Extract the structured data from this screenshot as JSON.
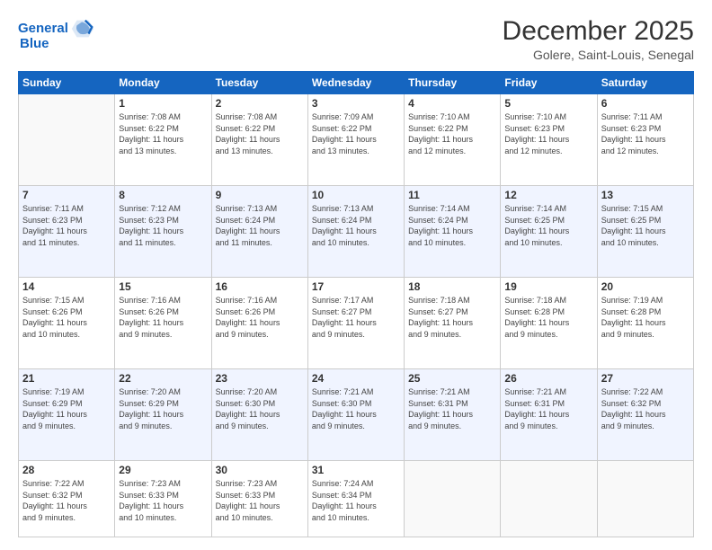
{
  "header": {
    "logo_line1": "General",
    "logo_line2": "Blue",
    "month_year": "December 2025",
    "location": "Golere, Saint-Louis, Senegal"
  },
  "days_of_week": [
    "Sunday",
    "Monday",
    "Tuesday",
    "Wednesday",
    "Thursday",
    "Friday",
    "Saturday"
  ],
  "weeks": [
    [
      {
        "day": "",
        "info": ""
      },
      {
        "day": "1",
        "info": "Sunrise: 7:08 AM\nSunset: 6:22 PM\nDaylight: 11 hours\nand 13 minutes."
      },
      {
        "day": "2",
        "info": "Sunrise: 7:08 AM\nSunset: 6:22 PM\nDaylight: 11 hours\nand 13 minutes."
      },
      {
        "day": "3",
        "info": "Sunrise: 7:09 AM\nSunset: 6:22 PM\nDaylight: 11 hours\nand 13 minutes."
      },
      {
        "day": "4",
        "info": "Sunrise: 7:10 AM\nSunset: 6:22 PM\nDaylight: 11 hours\nand 12 minutes."
      },
      {
        "day": "5",
        "info": "Sunrise: 7:10 AM\nSunset: 6:23 PM\nDaylight: 11 hours\nand 12 minutes."
      },
      {
        "day": "6",
        "info": "Sunrise: 7:11 AM\nSunset: 6:23 PM\nDaylight: 11 hours\nand 12 minutes."
      }
    ],
    [
      {
        "day": "7",
        "info": "Sunrise: 7:11 AM\nSunset: 6:23 PM\nDaylight: 11 hours\nand 11 minutes."
      },
      {
        "day": "8",
        "info": "Sunrise: 7:12 AM\nSunset: 6:23 PM\nDaylight: 11 hours\nand 11 minutes."
      },
      {
        "day": "9",
        "info": "Sunrise: 7:13 AM\nSunset: 6:24 PM\nDaylight: 11 hours\nand 11 minutes."
      },
      {
        "day": "10",
        "info": "Sunrise: 7:13 AM\nSunset: 6:24 PM\nDaylight: 11 hours\nand 10 minutes."
      },
      {
        "day": "11",
        "info": "Sunrise: 7:14 AM\nSunset: 6:24 PM\nDaylight: 11 hours\nand 10 minutes."
      },
      {
        "day": "12",
        "info": "Sunrise: 7:14 AM\nSunset: 6:25 PM\nDaylight: 11 hours\nand 10 minutes."
      },
      {
        "day": "13",
        "info": "Sunrise: 7:15 AM\nSunset: 6:25 PM\nDaylight: 11 hours\nand 10 minutes."
      }
    ],
    [
      {
        "day": "14",
        "info": "Sunrise: 7:15 AM\nSunset: 6:26 PM\nDaylight: 11 hours\nand 10 minutes."
      },
      {
        "day": "15",
        "info": "Sunrise: 7:16 AM\nSunset: 6:26 PM\nDaylight: 11 hours\nand 9 minutes."
      },
      {
        "day": "16",
        "info": "Sunrise: 7:16 AM\nSunset: 6:26 PM\nDaylight: 11 hours\nand 9 minutes."
      },
      {
        "day": "17",
        "info": "Sunrise: 7:17 AM\nSunset: 6:27 PM\nDaylight: 11 hours\nand 9 minutes."
      },
      {
        "day": "18",
        "info": "Sunrise: 7:18 AM\nSunset: 6:27 PM\nDaylight: 11 hours\nand 9 minutes."
      },
      {
        "day": "19",
        "info": "Sunrise: 7:18 AM\nSunset: 6:28 PM\nDaylight: 11 hours\nand 9 minutes."
      },
      {
        "day": "20",
        "info": "Sunrise: 7:19 AM\nSunset: 6:28 PM\nDaylight: 11 hours\nand 9 minutes."
      }
    ],
    [
      {
        "day": "21",
        "info": "Sunrise: 7:19 AM\nSunset: 6:29 PM\nDaylight: 11 hours\nand 9 minutes."
      },
      {
        "day": "22",
        "info": "Sunrise: 7:20 AM\nSunset: 6:29 PM\nDaylight: 11 hours\nand 9 minutes."
      },
      {
        "day": "23",
        "info": "Sunrise: 7:20 AM\nSunset: 6:30 PM\nDaylight: 11 hours\nand 9 minutes."
      },
      {
        "day": "24",
        "info": "Sunrise: 7:21 AM\nSunset: 6:30 PM\nDaylight: 11 hours\nand 9 minutes."
      },
      {
        "day": "25",
        "info": "Sunrise: 7:21 AM\nSunset: 6:31 PM\nDaylight: 11 hours\nand 9 minutes."
      },
      {
        "day": "26",
        "info": "Sunrise: 7:21 AM\nSunset: 6:31 PM\nDaylight: 11 hours\nand 9 minutes."
      },
      {
        "day": "27",
        "info": "Sunrise: 7:22 AM\nSunset: 6:32 PM\nDaylight: 11 hours\nand 9 minutes."
      }
    ],
    [
      {
        "day": "28",
        "info": "Sunrise: 7:22 AM\nSunset: 6:32 PM\nDaylight: 11 hours\nand 9 minutes."
      },
      {
        "day": "29",
        "info": "Sunrise: 7:23 AM\nSunset: 6:33 PM\nDaylight: 11 hours\nand 10 minutes."
      },
      {
        "day": "30",
        "info": "Sunrise: 7:23 AM\nSunset: 6:33 PM\nDaylight: 11 hours\nand 10 minutes."
      },
      {
        "day": "31",
        "info": "Sunrise: 7:24 AM\nSunset: 6:34 PM\nDaylight: 11 hours\nand 10 minutes."
      },
      {
        "day": "",
        "info": ""
      },
      {
        "day": "",
        "info": ""
      },
      {
        "day": "",
        "info": ""
      }
    ]
  ]
}
